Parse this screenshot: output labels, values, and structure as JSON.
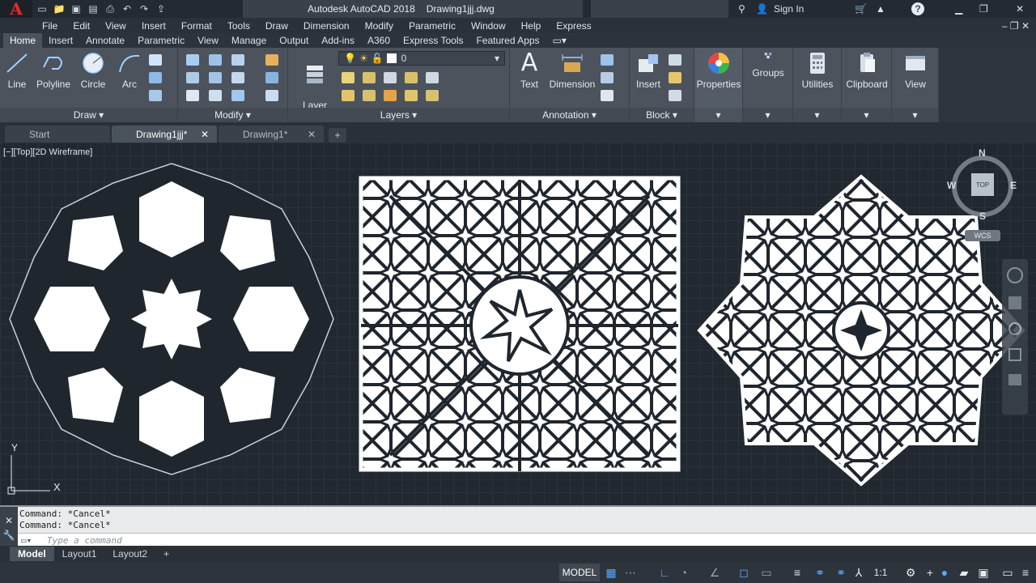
{
  "app": {
    "title": "Autodesk AutoCAD 2018",
    "file": "Drawing1jjj.dwg",
    "sign_in": "Sign In",
    "help": "?"
  },
  "menu": [
    "File",
    "Edit",
    "View",
    "Insert",
    "Format",
    "Tools",
    "Draw",
    "Dimension",
    "Modify",
    "Parametric",
    "Window",
    "Help",
    "Express"
  ],
  "ribbon_tabs": [
    "Home",
    "Insert",
    "Annotate",
    "Parametric",
    "View",
    "Manage",
    "Output",
    "Add-ins",
    "A360",
    "Express Tools",
    "Featured Apps"
  ],
  "ribbon": {
    "draw": {
      "title": "Draw",
      "tools": [
        "Line",
        "Polyline",
        "Circle",
        "Arc"
      ]
    },
    "modify": {
      "title": "Modify"
    },
    "layers": {
      "title": "Layers",
      "layer_properties": "Layer\nProperties",
      "current_layer": "0"
    },
    "annotation": {
      "title": "Annotation",
      "text": "Text",
      "dimension": "Dimension"
    },
    "block": {
      "title": "Block",
      "insert": "Insert"
    },
    "properties": "Properties",
    "groups": "Groups",
    "utilities": "Utilities",
    "clipboard": "Clipboard",
    "view": "View"
  },
  "doc_tabs": [
    "Start",
    "Drawing1jjj*",
    "Drawing1*"
  ],
  "viewport_label": "[−][Top][2D Wireframe]",
  "viewcube": {
    "top": "TOP",
    "n": "N",
    "s": "S",
    "e": "E",
    "w": "W",
    "wcs": "WCS"
  },
  "ucs": {
    "x": "X",
    "y": "Y"
  },
  "command": {
    "lines": [
      "Command: *Cancel*",
      "Command: *Cancel*"
    ],
    "placeholder": "Type a command"
  },
  "layout_tabs": [
    "Model",
    "Layout1",
    "Layout2"
  ],
  "status": {
    "model": "MODEL",
    "scale": "1:1"
  }
}
